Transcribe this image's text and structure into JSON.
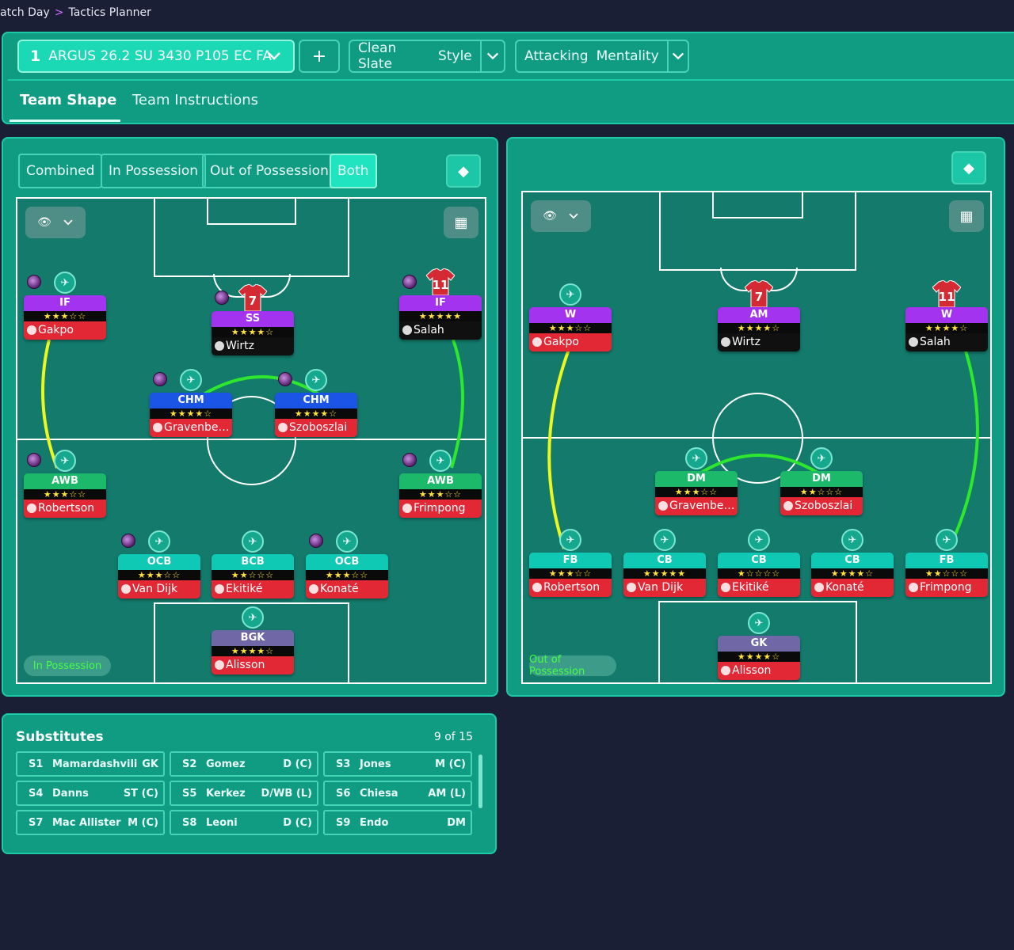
{
  "breadcrumb": {
    "parent": "atch Day",
    "current": "Tactics Planner"
  },
  "header": {
    "tactic_number": "1",
    "tactic_name": "ARGUS 26.2 SU 3430 P105 EC FA",
    "add_label": "+",
    "style_value": "Clean Slate",
    "style_label": "Style",
    "mentality_value": "Attacking",
    "mentality_label": "Mentality"
  },
  "tabs": [
    {
      "label": "Team Shape",
      "active": true
    },
    {
      "label": "Team Instructions",
      "active": false
    }
  ],
  "phase_buttons": [
    {
      "label": "Combined",
      "active": false
    },
    {
      "label": "In Possession",
      "active": false
    },
    {
      "label": "Out of Possession",
      "active": false
    },
    {
      "label": "Both",
      "active": true
    }
  ],
  "left_pitch": {
    "badge": "In Possession",
    "players": [
      {
        "role": "IF",
        "stars": "★★★☆☆",
        "name": "Gakpo",
        "shirt": "",
        "roleColor": "purple",
        "nameColor": "red"
      },
      {
        "role": "SS",
        "stars": "★★★★☆",
        "name": "Wirtz",
        "shirt": "7",
        "roleColor": "purple",
        "nameColor": "black"
      },
      {
        "role": "IF",
        "stars": "★★★★★",
        "name": "Salah",
        "shirt": "11",
        "roleColor": "purple",
        "nameColor": "black"
      },
      {
        "role": "CHM",
        "stars": "★★★★☆",
        "name": "Gravenber...",
        "shirt": "",
        "roleColor": "blue",
        "nameColor": "red"
      },
      {
        "role": "CHM",
        "stars": "★★★★☆",
        "name": "Szoboszlai",
        "shirt": "",
        "roleColor": "blue",
        "nameColor": "red"
      },
      {
        "role": "AWB",
        "stars": "★★★☆☆",
        "name": "Robertson",
        "shirt": "",
        "roleColor": "green",
        "nameColor": "red"
      },
      {
        "role": "AWB",
        "stars": "★★★☆☆",
        "name": "Frimpong",
        "shirt": "",
        "roleColor": "green",
        "nameColor": "red"
      },
      {
        "role": "OCB",
        "stars": "★★★☆☆",
        "name": "Van Dijk",
        "shirt": "",
        "roleColor": "teal",
        "nameColor": "red"
      },
      {
        "role": "BCB",
        "stars": "★★☆☆☆",
        "name": "Ekitiké",
        "shirt": "",
        "roleColor": "teal",
        "nameColor": "red"
      },
      {
        "role": "OCB",
        "stars": "★★★☆☆",
        "name": "Konaté",
        "shirt": "",
        "roleColor": "teal",
        "nameColor": "red"
      },
      {
        "role": "BGK",
        "stars": "★★★★☆",
        "name": "Alisson",
        "shirt": "",
        "roleColor": "slate",
        "nameColor": "red"
      }
    ]
  },
  "right_pitch": {
    "badge": "Out of Possession",
    "players": [
      {
        "role": "W",
        "stars": "★★★☆☆",
        "name": "Gakpo",
        "shirt": "",
        "roleColor": "purple",
        "nameColor": "red"
      },
      {
        "role": "AM",
        "stars": "★★★★☆",
        "name": "Wirtz",
        "shirt": "7",
        "roleColor": "purple",
        "nameColor": "black"
      },
      {
        "role": "W",
        "stars": "★★★★☆",
        "name": "Salah",
        "shirt": "11",
        "roleColor": "purple",
        "nameColor": "black"
      },
      {
        "role": "DM",
        "stars": "★★★☆☆",
        "name": "Gravenber...",
        "shirt": "",
        "roleColor": "green",
        "nameColor": "red"
      },
      {
        "role": "DM",
        "stars": "★★☆☆☆",
        "name": "Szoboszlai",
        "shirt": "",
        "roleColor": "green",
        "nameColor": "red"
      },
      {
        "role": "FB",
        "stars": "★★★☆☆",
        "name": "Robertson",
        "shirt": "",
        "roleColor": "teal",
        "nameColor": "red"
      },
      {
        "role": "CB",
        "stars": "★★★★★",
        "name": "Van Dijk",
        "shirt": "",
        "roleColor": "teal",
        "nameColor": "red"
      },
      {
        "role": "CB",
        "stars": "★☆☆☆☆",
        "name": "Ekitiké",
        "shirt": "",
        "roleColor": "teal",
        "nameColor": "red"
      },
      {
        "role": "CB",
        "stars": "★★★★☆",
        "name": "Konaté",
        "shirt": "",
        "roleColor": "teal",
        "nameColor": "red"
      },
      {
        "role": "FB",
        "stars": "★★☆☆☆",
        "name": "Frimpong",
        "shirt": "",
        "roleColor": "teal",
        "nameColor": "red"
      },
      {
        "role": "GK",
        "stars": "★★★★☆",
        "name": "Alisson",
        "shirt": "",
        "roleColor": "slate",
        "nameColor": "red"
      }
    ]
  },
  "substitutes": {
    "title": "Substitutes",
    "count": "9 of 15",
    "rows": [
      {
        "slot": "S1",
        "name": "Mamardashvili",
        "pos": "GK"
      },
      {
        "slot": "S2",
        "name": "Gomez",
        "pos": "D (C)"
      },
      {
        "slot": "S3",
        "name": "Jones",
        "pos": "M (C)"
      },
      {
        "slot": "S4",
        "name": "Danns",
        "pos": "ST (C)"
      },
      {
        "slot": "S5",
        "name": "Kerkez",
        "pos": "D/WB (L)"
      },
      {
        "slot": "S6",
        "name": "Chiesa",
        "pos": "AM (L)"
      },
      {
        "slot": "S7",
        "name": "Mac Allister",
        "pos": "M (C)"
      },
      {
        "slot": "S8",
        "name": "Leoni",
        "pos": "D (C)"
      },
      {
        "slot": "S9",
        "name": "Endo",
        "pos": "DM"
      }
    ]
  },
  "colors": {
    "accent": "#1cc9a8",
    "panel": "#0f9c83",
    "pitch": "#137a6c",
    "background": "#1b1f36"
  },
  "icons": {
    "eye": "eye-icon",
    "grid": "grid-icon",
    "diamond": "diamond-icon",
    "chevron": "chevron-down-icon"
  }
}
